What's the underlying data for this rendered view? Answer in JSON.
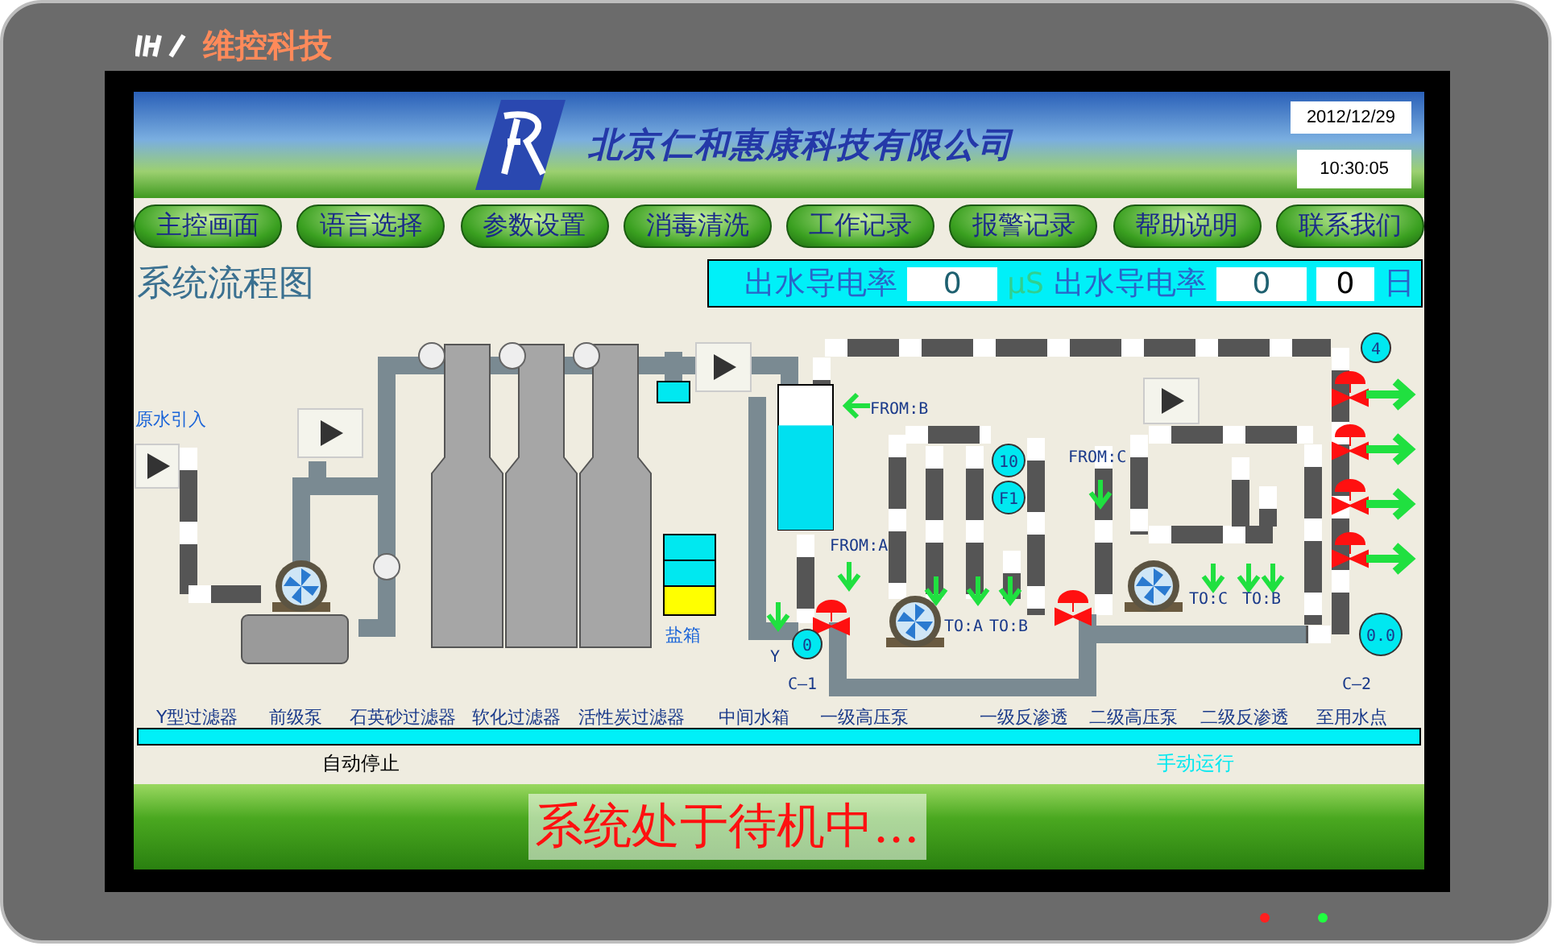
{
  "bezel": {
    "brand": "维控科技",
    "leds": [
      {
        "color": "#ff2020"
      },
      {
        "color": "#20ff40"
      }
    ]
  },
  "header": {
    "company": "北京仁和惠康科技有限公司",
    "date": "2012/12/29",
    "time": "10:30:05"
  },
  "nav": [
    {
      "label": "主控画面"
    },
    {
      "label": "语言选择"
    },
    {
      "label": "参数设置"
    },
    {
      "label": "消毒清洗"
    },
    {
      "label": "工作记录"
    },
    {
      "label": "报警记录"
    },
    {
      "label": "帮助说明"
    },
    {
      "label": "联系我们"
    }
  ],
  "title": "系统流程图",
  "conductivity": {
    "label_1": "出水导电率",
    "value_1": "0",
    "unit_1": "μS",
    "label_2": "出水导电率",
    "value_2": "0",
    "value_3": "0",
    "unit_3": "日"
  },
  "diagram": {
    "tank": {
      "level": 0.72
    },
    "labels": [
      {
        "text": "原水引入",
        "kind": "note"
      },
      {
        "text": "盐箱",
        "kind": "note"
      },
      {
        "text": "FROM:B",
        "kind": "tag"
      },
      {
        "text": "FROM:A",
        "kind": "tag"
      },
      {
        "text": "FROM:C",
        "kind": "tag"
      },
      {
        "text": "TO:A",
        "kind": "tag"
      },
      {
        "text": "TO:B",
        "kind": "tag"
      },
      {
        "text": "TO:C",
        "kind": "tag"
      },
      {
        "text": "TO:B",
        "kind": "tag"
      },
      {
        "text": "Y",
        "kind": "tag"
      },
      {
        "text": "C—1",
        "kind": "tag"
      },
      {
        "text": "C—2",
        "kind": "tag"
      }
    ],
    "gauges": [
      {
        "value": "0"
      },
      {
        "value": "10"
      },
      {
        "value": "F1"
      },
      {
        "value": "4"
      },
      {
        "value": "0.0"
      }
    ],
    "stages": [
      "Y型过滤器",
      "前级泵",
      "石英砂过滤器",
      "软化过滤器",
      "活性炭过滤器",
      "中间水箱",
      "一级高压泵",
      "一级反渗透",
      "二级高压泵",
      "二级反渗透",
      "至用水点"
    ]
  },
  "status": [
    {
      "text": "自动停止",
      "kind": "stopped"
    },
    {
      "text": "手动运行",
      "kind": "manual"
    }
  ],
  "banner": "系统处于待机中..."
}
